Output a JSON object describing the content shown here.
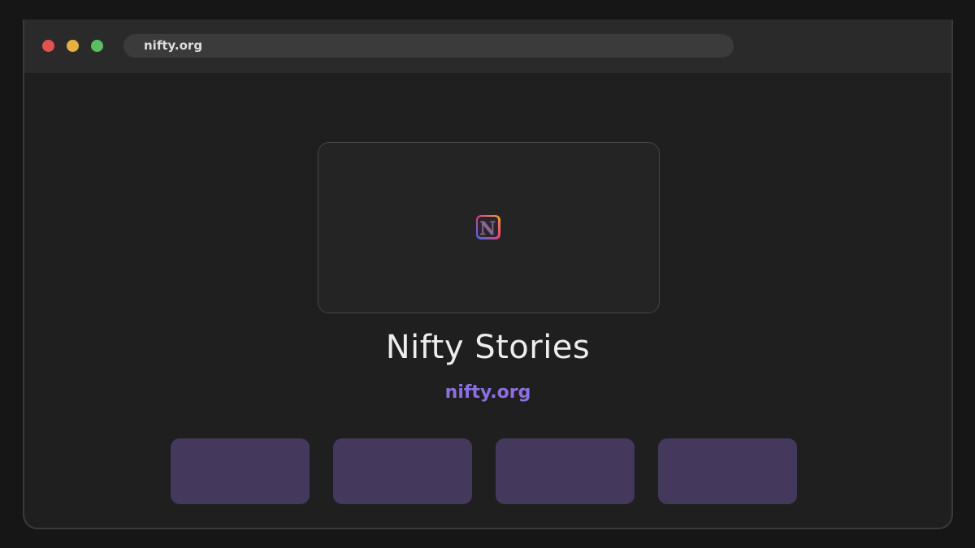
{
  "browser": {
    "url": "nifty.org"
  },
  "page": {
    "title": "Nifty Stories",
    "domain": "nifty.org",
    "logo_icon": "nifty-n-logo-icon"
  },
  "colors": {
    "close": "#e0534f",
    "minimize": "#e5b043",
    "maximize": "#5cbd63",
    "accent": "#8d6fe0",
    "tile": "#44385c"
  }
}
